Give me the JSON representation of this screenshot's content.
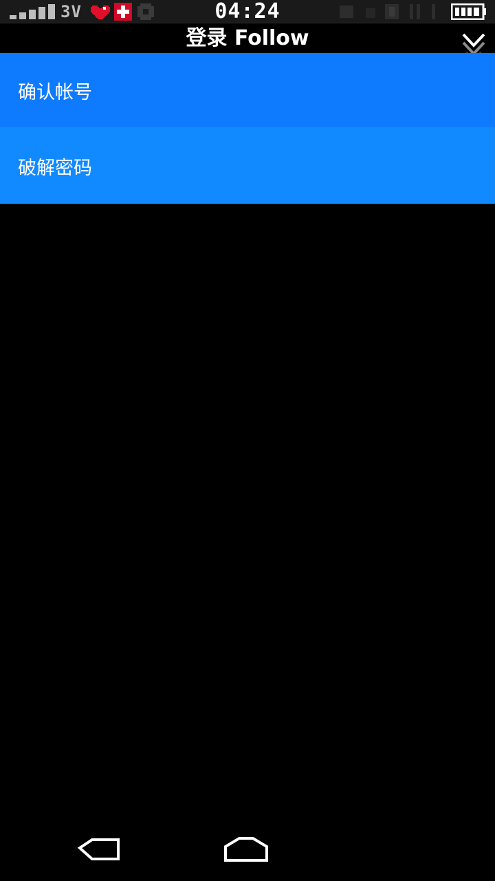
{
  "status_bar": {
    "network_type": "3V",
    "time": "04:24",
    "icons": [
      "signal-icon",
      "heart-icon",
      "medkit-icon",
      "misc-icon",
      "faded-status-icons",
      "battery-icon"
    ],
    "colors": {
      "heart": "#e0102a",
      "medkit": "#d10a2a",
      "text": "#ffffff"
    }
  },
  "header": {
    "title": "登录 Follow",
    "collapse_icon": "chevron-down-icon"
  },
  "menu": {
    "items": [
      {
        "label": "确认帐号"
      },
      {
        "label": "破解密码"
      }
    ],
    "colors": {
      "item_1": "#0e7bff",
      "item_2": "#128aff"
    }
  },
  "nav_bar": {
    "buttons": [
      "back-icon",
      "home-icon"
    ]
  }
}
